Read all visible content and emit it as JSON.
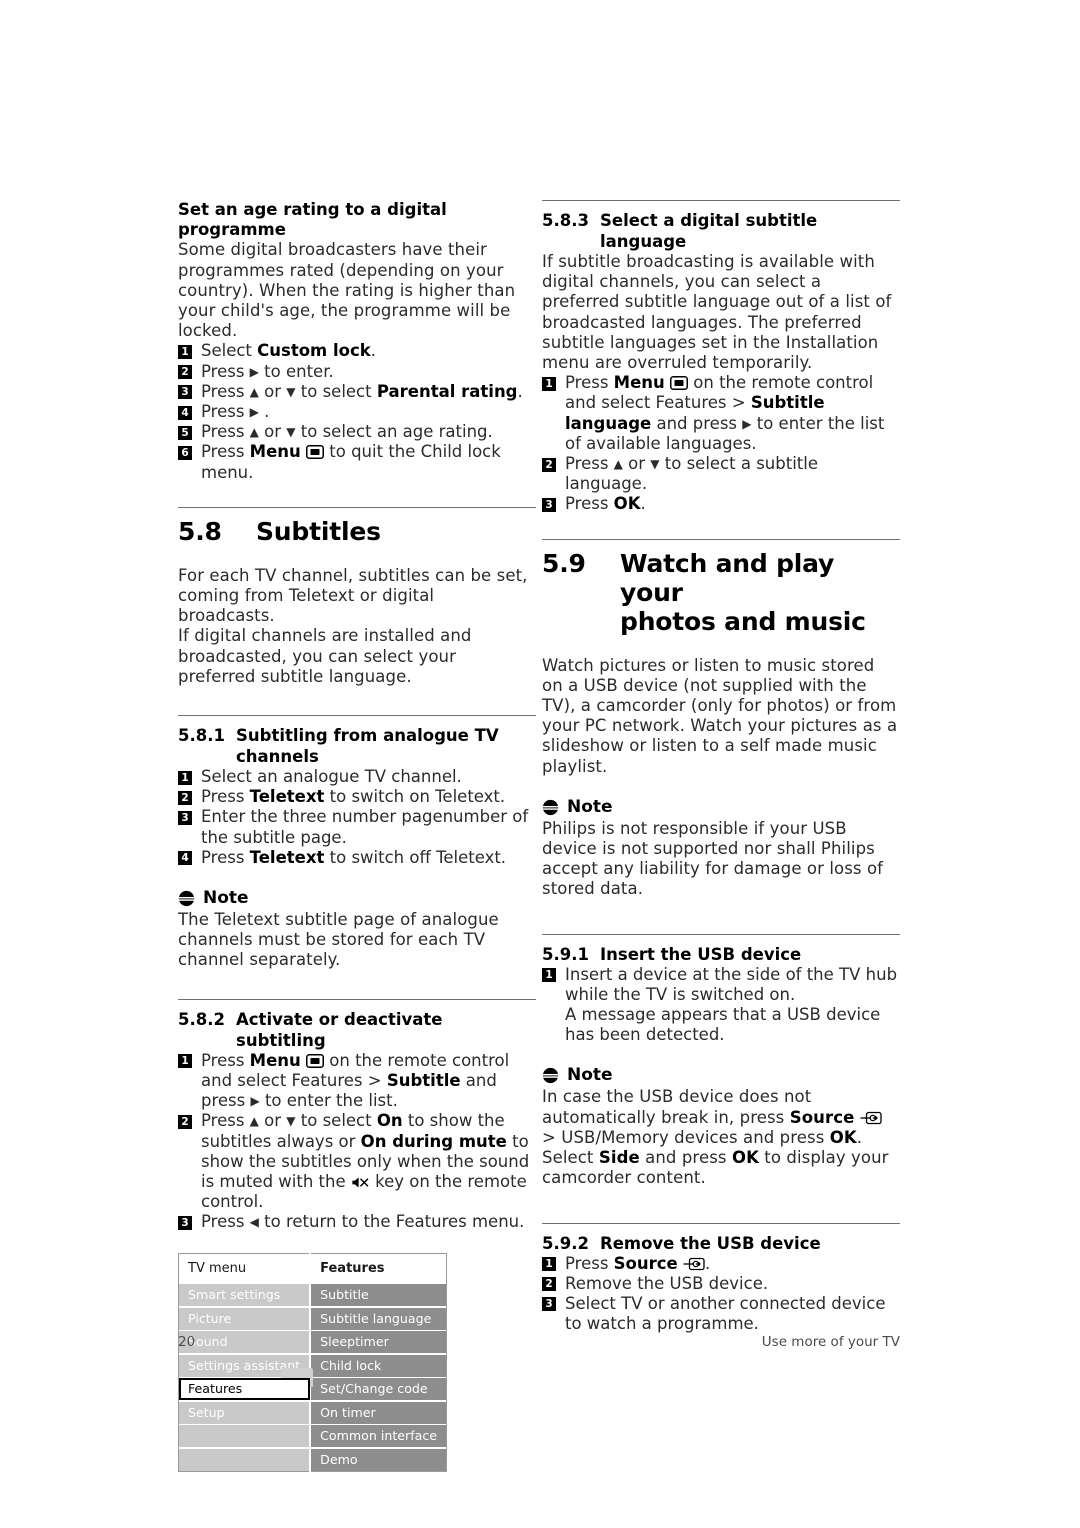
{
  "page": {
    "number": "20",
    "footer_right": "Use more of your TV"
  },
  "left_column": {
    "age_rating": {
      "heading": "Set an age rating to a digital programme",
      "paragraph": "Some digital broadcasters have their programmes rated (depending on your country). When the rating is higher than your child's age, the programme will be locked.",
      "steps": [
        {
          "num": "1",
          "pre": "Select ",
          "bold": "Custom lock",
          "post": "."
        },
        {
          "num": "2",
          "pre": "Press ",
          "arrow": "▶",
          "post": " to enter."
        },
        {
          "num": "3",
          "pre": "Press ",
          "arrow": "▲",
          "mid": " or ",
          "arrow2": "▼",
          "mid2": " to select ",
          "bold": "Parental rating",
          "post": "."
        },
        {
          "num": "4",
          "pre": "Press ",
          "arrow": "▶",
          "post": " ."
        },
        {
          "num": "5",
          "pre": "Press ",
          "arrow": "▲",
          "mid": " or ",
          "arrow2": "▼",
          "mid2": " to select an age rating.",
          "post": ""
        },
        {
          "num": "6",
          "pre": "Press ",
          "bold": "Menu",
          "icon": "menu-icon",
          "post": " to quit the Child lock menu."
        }
      ]
    },
    "section_58": {
      "number": "5.8",
      "title": "Subtitles",
      "paragraph1": "For each TV channel, subtitles can be set, coming from Teletext or digital broadcasts.",
      "paragraph2": "If digital channels are installed and broadcasted, you can select your preferred subtitle language."
    },
    "section_581": {
      "number": "5.8.1",
      "title": "Subtitling from analogue TV channels",
      "steps": [
        {
          "num": "1",
          "text": "Select an analogue TV channel."
        },
        {
          "num": "2",
          "pre": "Press ",
          "bold": "Teletext",
          "post": " to switch on Teletext."
        },
        {
          "num": "3",
          "text": "Enter the three number pagenumber of the subtitle page."
        },
        {
          "num": "4",
          "pre": "Press ",
          "bold": "Teletext",
          "post": " to switch off Teletext."
        }
      ],
      "note": {
        "label": "Note",
        "text": "The Teletext subtitle page of analogue channels must be stored for each TV channel separately."
      }
    },
    "section_582": {
      "number": "5.8.2",
      "title": "Activate or deactivate subtitling",
      "step1": {
        "num": "1",
        "part_a": "Press ",
        "bold_menu": "Menu",
        "icon": "menu-icon",
        "part_b": " on the remote control and select Features > ",
        "bold_subtitle": "Subtitle",
        "part_c": " and press ",
        "arrow": "▶",
        "part_d": " to enter the list."
      },
      "step2": {
        "num": "2",
        "part_a": "Press ",
        "arrow_up": "▲",
        "part_b": " or ",
        "arrow_down": "▼",
        "part_c": " to select ",
        "bold_on": "On",
        "part_d": " to show the subtitles always or ",
        "bold_mute": "On during mute",
        "part_e": " to show the subtitles only when the sound is muted with the ",
        "icon": "mute-icon",
        "part_f": " key on the remote control."
      },
      "step3": {
        "num": "3",
        "part_a": "Press ",
        "arrow_left": "◀",
        "part_b": " to return to the Features menu."
      }
    },
    "tv_menu_table": {
      "header_left": "TV menu",
      "header_right": "Features",
      "left_items": [
        "Smart settings",
        "Picture",
        "Sound",
        "Settings assistant",
        "Features",
        "Setup",
        "",
        ""
      ],
      "left_selected_index": 4,
      "right_items": [
        "Subtitle",
        "Subtitle language",
        "Sleeptimer",
        "Child lock",
        "Set/Change code",
        "On timer",
        "Common interface",
        "Demo"
      ]
    }
  },
  "right_column": {
    "section_583": {
      "number": "5.8.3",
      "title": "Select a digital subtitle language",
      "paragraph": "If subtitle broadcasting is available with digital channels, you can select a preferred subtitle language out of a list of broadcasted languages. The preferred subtitle languages set in the Installation menu are overruled temporarily.",
      "step1": {
        "num": "1",
        "part_a": "Press ",
        "bold_menu": "Menu",
        "icon": "menu-icon",
        "part_b": " on the remote control and select Features > ",
        "bold_sublang": "Subtitle language",
        "part_c": " and press ",
        "arrow": "▶",
        "part_d": " to enter the list of available languages."
      },
      "step2": {
        "num": "2",
        "part_a": "Press ",
        "arrow_up": "▲",
        "part_b": " or ",
        "arrow_down": "▼",
        "part_c": " to select a subtitle language."
      },
      "step3": {
        "num": "3",
        "part_a": "Press ",
        "bold_ok": "OK",
        "part_b": "."
      }
    },
    "section_59": {
      "number": "5.9",
      "title_line1": "Watch and play your",
      "title_line2": "photos and music",
      "paragraph": "Watch pictures or listen to music stored on a USB device (not supplied with the TV), a camcorder (only for photos) or from your PC network. Watch your pictures as a slideshow or listen to a self made music playlist.",
      "note": {
        "label": "Note",
        "text": "Philips is not responsible if your USB device is not supported nor shall Philips accept any liability for damage or loss of stored data."
      }
    },
    "section_591": {
      "number": "5.9.1",
      "title": "Insert the USB device",
      "step1": {
        "num": "1",
        "text": "Insert a device at the side of the TV hub while the TV is switched on.",
        "continuation": "A message appears that a USB device has been detected."
      },
      "note": {
        "label": "Note",
        "part_a": "In case the USB device does not automatically break in, press ",
        "bold_source": "Source",
        "icon": "source-icon",
        "part_b": " > USB/Memory devices and press ",
        "bold_ok": "OK",
        "part_c": ".",
        "line2_a": "Select ",
        "bold_side": "Side",
        "line2_b": " and press ",
        "bold_ok2": "OK",
        "line2_c": " to display your camcorder content."
      }
    },
    "section_592": {
      "number": "5.9.2",
      "title": "Remove the USB device",
      "steps": [
        {
          "num": "1",
          "pre": "Press ",
          "bold": "Source",
          "icon": "source-icon",
          "post": "."
        },
        {
          "num": "2",
          "text": "Remove the USB device."
        },
        {
          "num": "3",
          "text": "Select TV or another connected device to watch a programme."
        }
      ]
    }
  },
  "colors": {
    "text": "#2b2b2b",
    "heading": "#000000",
    "rule": "#6f6f6f",
    "menu_left_bg": "#c9c9c9",
    "menu_right_bg": "#8d8d8d",
    "menu_text": "#ffffff",
    "footer_text": "#4a4a4a"
  }
}
